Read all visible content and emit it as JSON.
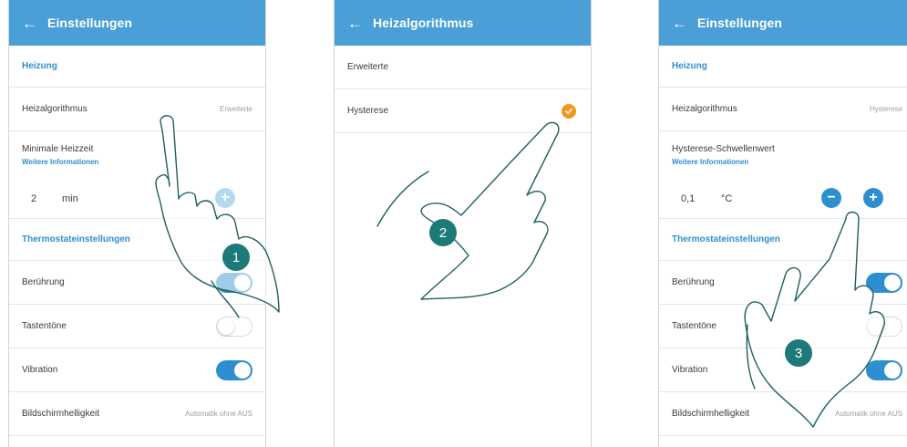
{
  "screen1": {
    "title": "Einstellungen",
    "section_heating": "Heizung",
    "algorithm_label": "Heizalgorithmus",
    "algorithm_value": "Erweiterte",
    "min_time_label": "Minimale Heizzeit",
    "more_info": "Weitere Informationen",
    "min_time_value": "2",
    "min_time_unit": "min",
    "plus_glyph": "+",
    "section_thermostat": "Thermostateinstellungen",
    "touch_label": "Berührung",
    "touch_on": true,
    "key_tones_label": "Tastentöne",
    "key_tones_on": false,
    "vibration_label": "Vibration",
    "vibration_on": true,
    "brightness_label": "Bildschirmhelligkeit",
    "brightness_value": "Automatik ohne AUS",
    "step": "1"
  },
  "screen2": {
    "title": "Heizalgorithmus",
    "option_advanced": "Erweiterte",
    "option_hysteresis": "Hysterese",
    "selected_icon": "check-icon",
    "step": "2"
  },
  "screen3": {
    "title": "Einstellungen",
    "section_heating": "Heizung",
    "algorithm_label": "Heizalgorithmus",
    "algorithm_value": "Hysterese",
    "threshold_label": "Hysterese-Schwellenwert",
    "more_info": "Weitere Informationen",
    "threshold_value": "0,1",
    "threshold_unit": "°C",
    "minus_glyph": "−",
    "plus_glyph": "+",
    "section_thermostat": "Thermostateinstellungen",
    "touch_label": "Berührung",
    "key_tones_label": "Tastentöne",
    "vibration_label": "Vibration",
    "brightness_label": "Bildschirmhelligkeit",
    "brightness_value": "Automatik ohne AUS",
    "step": "3"
  },
  "common": {
    "back_glyph": "←",
    "accent": "#4a9fd6",
    "link_color": "#2e8fd0",
    "check_color": "#f5961f",
    "step_color": "#1e7a78"
  }
}
